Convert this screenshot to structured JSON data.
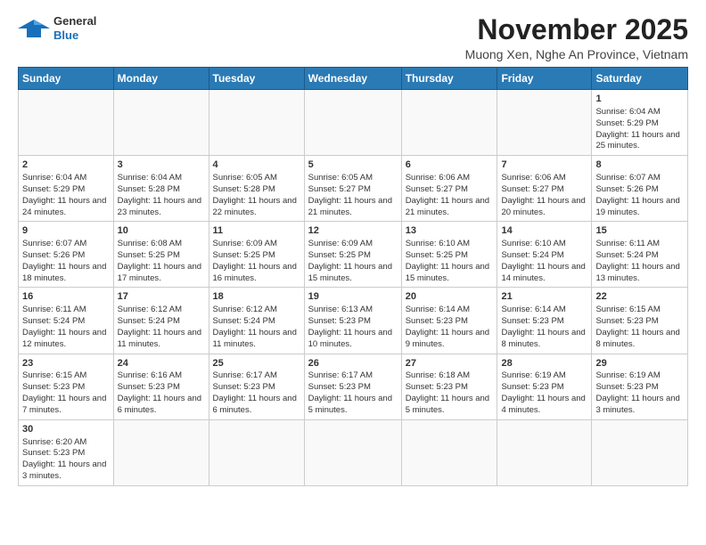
{
  "header": {
    "logo_general": "General",
    "logo_blue": "Blue",
    "month_title": "November 2025",
    "subtitle": "Muong Xen, Nghe An Province, Vietnam"
  },
  "days_of_week": [
    "Sunday",
    "Monday",
    "Tuesday",
    "Wednesday",
    "Thursday",
    "Friday",
    "Saturday"
  ],
  "weeks": [
    [
      {
        "day": null
      },
      {
        "day": null
      },
      {
        "day": null
      },
      {
        "day": null
      },
      {
        "day": null
      },
      {
        "day": null
      },
      {
        "day": 1,
        "sunrise": "Sunrise: 6:04 AM",
        "sunset": "Sunset: 5:29 PM",
        "daylight": "Daylight: 11 hours and 25 minutes."
      }
    ],
    [
      {
        "day": 2,
        "sunrise": "Sunrise: 6:04 AM",
        "sunset": "Sunset: 5:29 PM",
        "daylight": "Daylight: 11 hours and 24 minutes."
      },
      {
        "day": 3,
        "sunrise": "Sunrise: 6:04 AM",
        "sunset": "Sunset: 5:28 PM",
        "daylight": "Daylight: 11 hours and 23 minutes."
      },
      {
        "day": 4,
        "sunrise": "Sunrise: 6:05 AM",
        "sunset": "Sunset: 5:28 PM",
        "daylight": "Daylight: 11 hours and 22 minutes."
      },
      {
        "day": 5,
        "sunrise": "Sunrise: 6:05 AM",
        "sunset": "Sunset: 5:27 PM",
        "daylight": "Daylight: 11 hours and 21 minutes."
      },
      {
        "day": 6,
        "sunrise": "Sunrise: 6:06 AM",
        "sunset": "Sunset: 5:27 PM",
        "daylight": "Daylight: 11 hours and 21 minutes."
      },
      {
        "day": 7,
        "sunrise": "Sunrise: 6:06 AM",
        "sunset": "Sunset: 5:27 PM",
        "daylight": "Daylight: 11 hours and 20 minutes."
      },
      {
        "day": 8,
        "sunrise": "Sunrise: 6:07 AM",
        "sunset": "Sunset: 5:26 PM",
        "daylight": "Daylight: 11 hours and 19 minutes."
      }
    ],
    [
      {
        "day": 9,
        "sunrise": "Sunrise: 6:07 AM",
        "sunset": "Sunset: 5:26 PM",
        "daylight": "Daylight: 11 hours and 18 minutes."
      },
      {
        "day": 10,
        "sunrise": "Sunrise: 6:08 AM",
        "sunset": "Sunset: 5:25 PM",
        "daylight": "Daylight: 11 hours and 17 minutes."
      },
      {
        "day": 11,
        "sunrise": "Sunrise: 6:09 AM",
        "sunset": "Sunset: 5:25 PM",
        "daylight": "Daylight: 11 hours and 16 minutes."
      },
      {
        "day": 12,
        "sunrise": "Sunrise: 6:09 AM",
        "sunset": "Sunset: 5:25 PM",
        "daylight": "Daylight: 11 hours and 15 minutes."
      },
      {
        "day": 13,
        "sunrise": "Sunrise: 6:10 AM",
        "sunset": "Sunset: 5:25 PM",
        "daylight": "Daylight: 11 hours and 15 minutes."
      },
      {
        "day": 14,
        "sunrise": "Sunrise: 6:10 AM",
        "sunset": "Sunset: 5:24 PM",
        "daylight": "Daylight: 11 hours and 14 minutes."
      },
      {
        "day": 15,
        "sunrise": "Sunrise: 6:11 AM",
        "sunset": "Sunset: 5:24 PM",
        "daylight": "Daylight: 11 hours and 13 minutes."
      }
    ],
    [
      {
        "day": 16,
        "sunrise": "Sunrise: 6:11 AM",
        "sunset": "Sunset: 5:24 PM",
        "daylight": "Daylight: 11 hours and 12 minutes."
      },
      {
        "day": 17,
        "sunrise": "Sunrise: 6:12 AM",
        "sunset": "Sunset: 5:24 PM",
        "daylight": "Daylight: 11 hours and 11 minutes."
      },
      {
        "day": 18,
        "sunrise": "Sunrise: 6:12 AM",
        "sunset": "Sunset: 5:24 PM",
        "daylight": "Daylight: 11 hours and 11 minutes."
      },
      {
        "day": 19,
        "sunrise": "Sunrise: 6:13 AM",
        "sunset": "Sunset: 5:23 PM",
        "daylight": "Daylight: 11 hours and 10 minutes."
      },
      {
        "day": 20,
        "sunrise": "Sunrise: 6:14 AM",
        "sunset": "Sunset: 5:23 PM",
        "daylight": "Daylight: 11 hours and 9 minutes."
      },
      {
        "day": 21,
        "sunrise": "Sunrise: 6:14 AM",
        "sunset": "Sunset: 5:23 PM",
        "daylight": "Daylight: 11 hours and 8 minutes."
      },
      {
        "day": 22,
        "sunrise": "Sunrise: 6:15 AM",
        "sunset": "Sunset: 5:23 PM",
        "daylight": "Daylight: 11 hours and 8 minutes."
      }
    ],
    [
      {
        "day": 23,
        "sunrise": "Sunrise: 6:15 AM",
        "sunset": "Sunset: 5:23 PM",
        "daylight": "Daylight: 11 hours and 7 minutes."
      },
      {
        "day": 24,
        "sunrise": "Sunrise: 6:16 AM",
        "sunset": "Sunset: 5:23 PM",
        "daylight": "Daylight: 11 hours and 6 minutes."
      },
      {
        "day": 25,
        "sunrise": "Sunrise: 6:17 AM",
        "sunset": "Sunset: 5:23 PM",
        "daylight": "Daylight: 11 hours and 6 minutes."
      },
      {
        "day": 26,
        "sunrise": "Sunrise: 6:17 AM",
        "sunset": "Sunset: 5:23 PM",
        "daylight": "Daylight: 11 hours and 5 minutes."
      },
      {
        "day": 27,
        "sunrise": "Sunrise: 6:18 AM",
        "sunset": "Sunset: 5:23 PM",
        "daylight": "Daylight: 11 hours and 5 minutes."
      },
      {
        "day": 28,
        "sunrise": "Sunrise: 6:19 AM",
        "sunset": "Sunset: 5:23 PM",
        "daylight": "Daylight: 11 hours and 4 minutes."
      },
      {
        "day": 29,
        "sunrise": "Sunrise: 6:19 AM",
        "sunset": "Sunset: 5:23 PM",
        "daylight": "Daylight: 11 hours and 3 minutes."
      }
    ],
    [
      {
        "day": 30,
        "sunrise": "Sunrise: 6:20 AM",
        "sunset": "Sunset: 5:23 PM",
        "daylight": "Daylight: 11 hours and 3 minutes."
      },
      {
        "day": null
      },
      {
        "day": null
      },
      {
        "day": null
      },
      {
        "day": null
      },
      {
        "day": null
      },
      {
        "day": null
      }
    ]
  ]
}
